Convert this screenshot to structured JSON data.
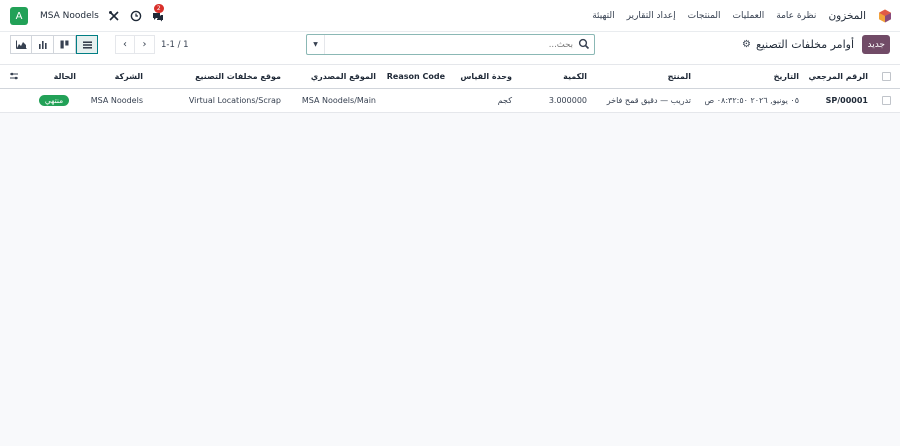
{
  "navbar": {
    "app_name": "المخزون",
    "menu": [
      "نظرة عامة",
      "العمليات",
      "المنتجات",
      "إعداد التقارير",
      "التهيئة"
    ],
    "avatar_letter": "A",
    "company": "MSA Noodels",
    "chat_badge": "2",
    "brand_color": "#714b67"
  },
  "control": {
    "new_label": "جديد",
    "title": "أوامر مخلفات التصنيع",
    "search_placeholder": "بحث...",
    "pager_text": "1-1 / 1"
  },
  "table": {
    "headers": {
      "reference": "الرقم المرجعي",
      "date": "التاريخ",
      "product": "المنتج",
      "quantity": "الكمية",
      "uom": "وحدة القياس",
      "reason": "Reason Code",
      "source_location": "الموقع المصدري",
      "scrap_location": "موقع مخلفات التصنيع",
      "company": "الشركة",
      "status": "الحالة"
    },
    "rows": [
      {
        "reference": "SP/00001",
        "date": "٠٥ يونيو, ٢٠٢٦ ٠٨:٣٢:٥٠ ص",
        "product": "تدريب — دقيق قمح فاخر",
        "quantity": "3.000000",
        "uom": "كجم",
        "reason": "",
        "source_location": "MSA Noodels/Main",
        "scrap_location": "Virtual Locations/Scrap",
        "company": "MSA Noodels",
        "status": "منتهي"
      }
    ]
  },
  "colors": {
    "status_done": "#22a157",
    "avatar": "#22a157",
    "search_border": "#8bb8b5"
  }
}
